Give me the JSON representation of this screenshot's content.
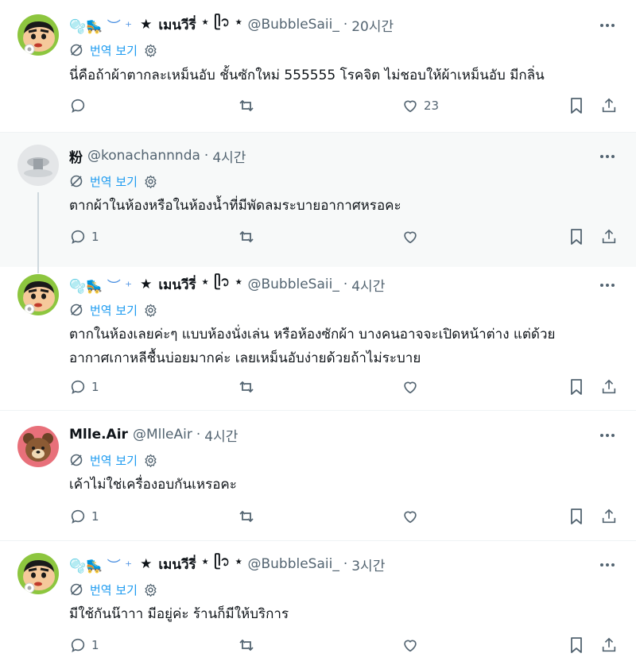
{
  "translate_label": "번역 보기",
  "tweets": [
    {
      "name": "🫧🛼 ︶꒰ ★ เมนวีรี่ ⋆ ⁽ᐢ ⋆ 🫧",
      "name_parts": {
        "deco": "🫧🛼 ︶ ⁺",
        "star": "★",
        "main": "เมนวีรี่",
        "tail": "⋆ ᥫ᭡ ⋆"
      },
      "handle": "@BubbleSaii_",
      "time": "20시간",
      "text": "นี่คือถ้าผ้าตากละเหม็นอับ ชั้นซักใหม่ 555555 โรคจิต ไม่ชอบให้ผ้าเหม็นอับ มีกลิ่น",
      "replies": "",
      "likes": "23"
    },
    {
      "name": "粉",
      "handle": "@konachannnda",
      "time": "4시간",
      "text": "ตากผ้าในห้องหรือในห้องน้ำที่มีพัดลมระบายอากาศหรอคะ",
      "replies": "1",
      "likes": ""
    },
    {
      "name_parts": {
        "deco": "🫧🛼 ︶ ⁺",
        "star": "★",
        "main": "เมนวีรี่",
        "tail": "⋆ ᥫ᭡ ⋆"
      },
      "handle": "@BubbleSaii_",
      "time": "4시간",
      "text_line1": "ตากในห้องเลยค่ะๆ แบบห้องนั่งเล่น หรือห้องซักผ้า บางคนอาจจะเปิดหน้าต่าง แต่ด้วย",
      "text_line2": "อากาศเกาหลีชื้นบ่อยมากค่ะ เลยเหม็นอับง่ายด้วยถ้าไม่ระบาย",
      "replies": "1",
      "likes": ""
    },
    {
      "name": "Mlle.Air",
      "handle": "@MlleAir",
      "time": "4시간",
      "text": "เค้าไม่ใช่เครื่องอบกันเหรอคะ",
      "replies": "1",
      "likes": ""
    },
    {
      "name_parts": {
        "deco": "🫧🛼 ︶ ⁺",
        "star": "★",
        "main": "เมนวีรี่",
        "tail": "⋆ ᥫ᭡ ⋆"
      },
      "handle": "@BubbleSaii_",
      "time": "3시간",
      "text": "มีใช้กันน๊าาา มีอยู่ค่ะ ร้านก็มีให้บริการ",
      "replies": "1",
      "likes": ""
    }
  ],
  "colors": {
    "accent": "#1d9bf0",
    "secondary_text": "#536471",
    "primary_text": "#0f1419",
    "reply_bg": "#f7f9f9"
  }
}
